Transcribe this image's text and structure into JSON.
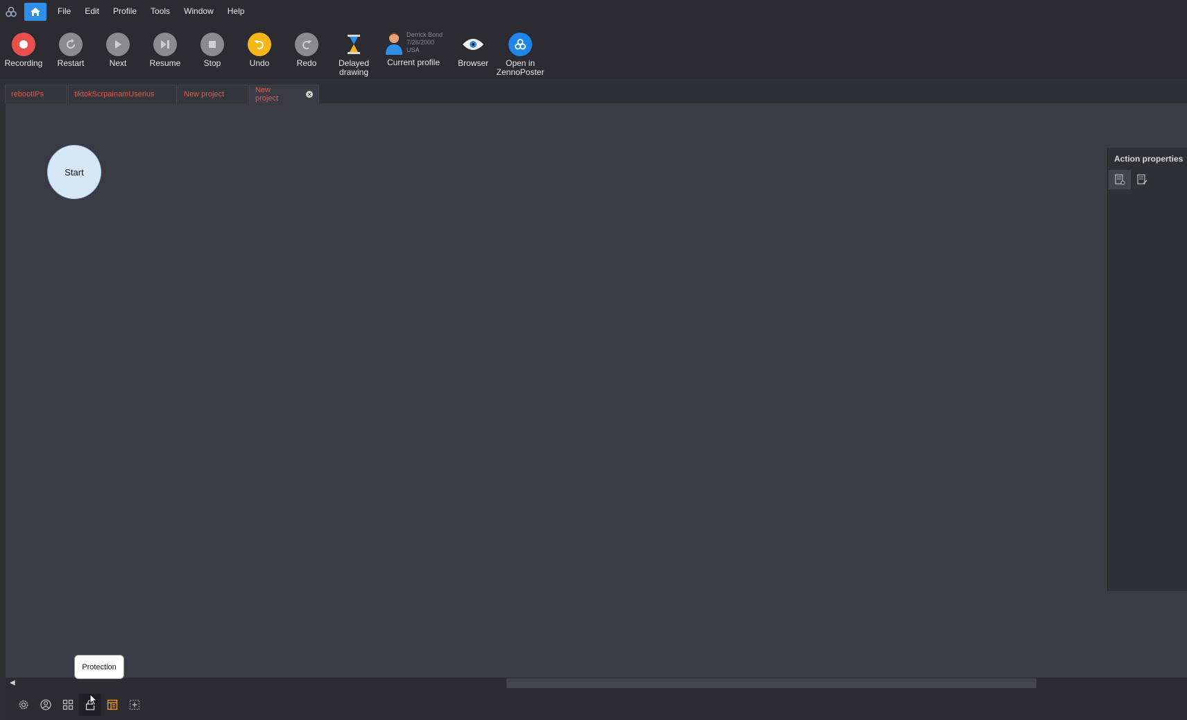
{
  "menubar": {
    "items": [
      "File",
      "Edit",
      "Profile",
      "Tools",
      "Window",
      "Help"
    ]
  },
  "toolbar": {
    "recording": "Recording",
    "restart": "Restart",
    "next": "Next",
    "resume": "Resume",
    "stop": "Stop",
    "undo": "Undo",
    "redo": "Redo",
    "delayed_drawing": "Delayed\ndrawing",
    "profile": {
      "name": "Derrick Bond",
      "date": "7/26/2000",
      "country": "USA",
      "label": "Current profile"
    },
    "browser": "Browser",
    "open_zenno": "Open in\nZennoPoster"
  },
  "tabs": [
    {
      "label": "rebootIPs"
    },
    {
      "label": "tiktokScrpainamUserius"
    },
    {
      "label": "New project"
    },
    {
      "label": "New project",
      "active": true
    }
  ],
  "canvas": {
    "start_node": "Start"
  },
  "action_properties": {
    "title": "Action properties"
  },
  "tooltip": {
    "text": "Protection"
  },
  "colors": {
    "accent": "#2f8fe8",
    "tab_text": "#e05a52",
    "record": "#e8504f",
    "undo": "#f7b618"
  }
}
